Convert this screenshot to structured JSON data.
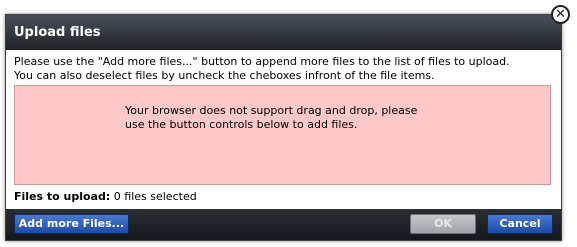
{
  "dialog": {
    "title": "Upload files",
    "instructions_line1": "Please use the \"Add more files...\" button to append more files to the list of files to upload.",
    "instructions_line2": "You can also deselect files by uncheck the cheboxes infront of the file items.",
    "dropzone_line1": "Your browser does not support drag and drop, please",
    "dropzone_line2": "use the button controls below to add files.",
    "files_label": "Files to upload:",
    "files_value": "0 files selected",
    "close_glyph": "✕",
    "buttons": {
      "add": "Add more Files...",
      "ok": "OK",
      "cancel": "Cancel"
    }
  },
  "colors": {
    "dropzone": "#ffc9c9",
    "accent_button": "#2b5bbd",
    "titlebar": "#2f3338"
  }
}
